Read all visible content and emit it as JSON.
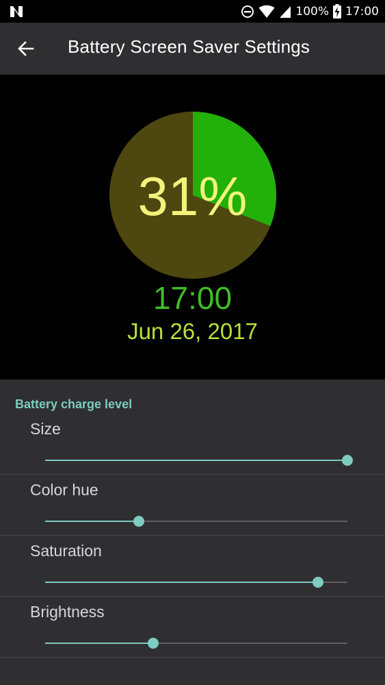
{
  "status_bar": {
    "battery_text": "100%",
    "time": "17:00",
    "icons": [
      "notification-n-icon",
      "do-not-disturb-icon",
      "wifi-icon",
      "cell-signal-icon",
      "battery-charging-icon"
    ]
  },
  "toolbar": {
    "back_icon": "arrow-left-icon",
    "title": "Battery Screen Saver Settings"
  },
  "preview": {
    "percent_text": "31%",
    "charge_fraction": 0.31,
    "time": "17:00",
    "date": "Jun 26, 2017",
    "colors": {
      "charged": "#22b00b",
      "remaining": "#4e470f",
      "percent_text": "#f3f27a",
      "time_text": "#3fbd25",
      "date_text": "#b9e13a"
    }
  },
  "settings": {
    "section_title": "Battery charge level",
    "accent_color": "#7ecbc0",
    "items": [
      {
        "label": "Size",
        "value": 1.0
      },
      {
        "label": "Color hue",
        "value": 0.31
      },
      {
        "label": "Saturation",
        "value": 0.903
      },
      {
        "label": "Brightness",
        "value": 0.357
      }
    ]
  }
}
